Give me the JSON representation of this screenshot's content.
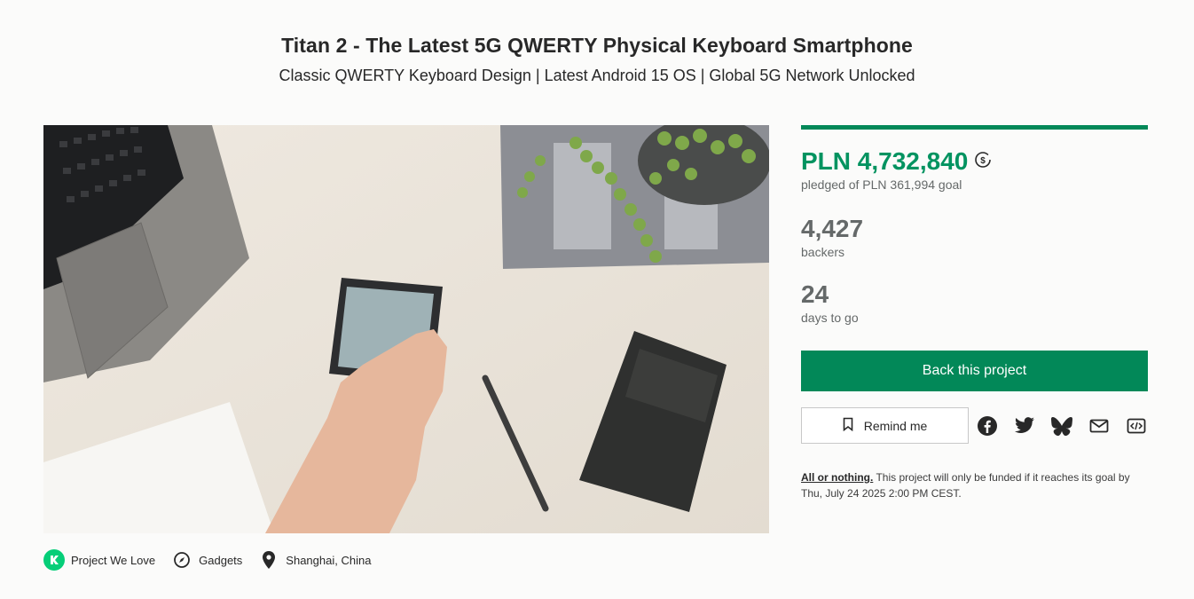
{
  "header": {
    "title": "Titan 2 - The Latest 5G QWERTY Physical Keyboard Smartphone",
    "subtitle": "Classic QWERTY Keyboard Design | Latest Android 15 OS | Global 5G Network Unlocked"
  },
  "tags": [
    {
      "label": "Project We Love",
      "icon": "kickstarter-k-icon"
    },
    {
      "label": "Gadgets",
      "icon": "compass-icon"
    },
    {
      "label": "Shanghai, China",
      "icon": "location-pin-icon"
    }
  ],
  "funding": {
    "pledged": "PLN 4,732,840",
    "pledged_caption": "pledged of PLN 361,994 goal",
    "backers": "4,427",
    "backers_caption": "backers",
    "days": "24",
    "days_caption": "days to go",
    "progress_fraction": 1.0
  },
  "actions": {
    "back_label": "Back this project",
    "remind_label": "Remind me",
    "share_icons": [
      "facebook-icon",
      "twitter-icon",
      "bluesky-icon",
      "email-icon",
      "embed-icon"
    ]
  },
  "notice": {
    "link_text": "All or nothing.",
    "text": " This project will only be funded if it reaches its goal by Thu, July 24 2025 2:00 PM CEST."
  },
  "colors": {
    "accent": "#028858",
    "pledged_text": "#029360",
    "pwl_badge": "#05ce78"
  }
}
